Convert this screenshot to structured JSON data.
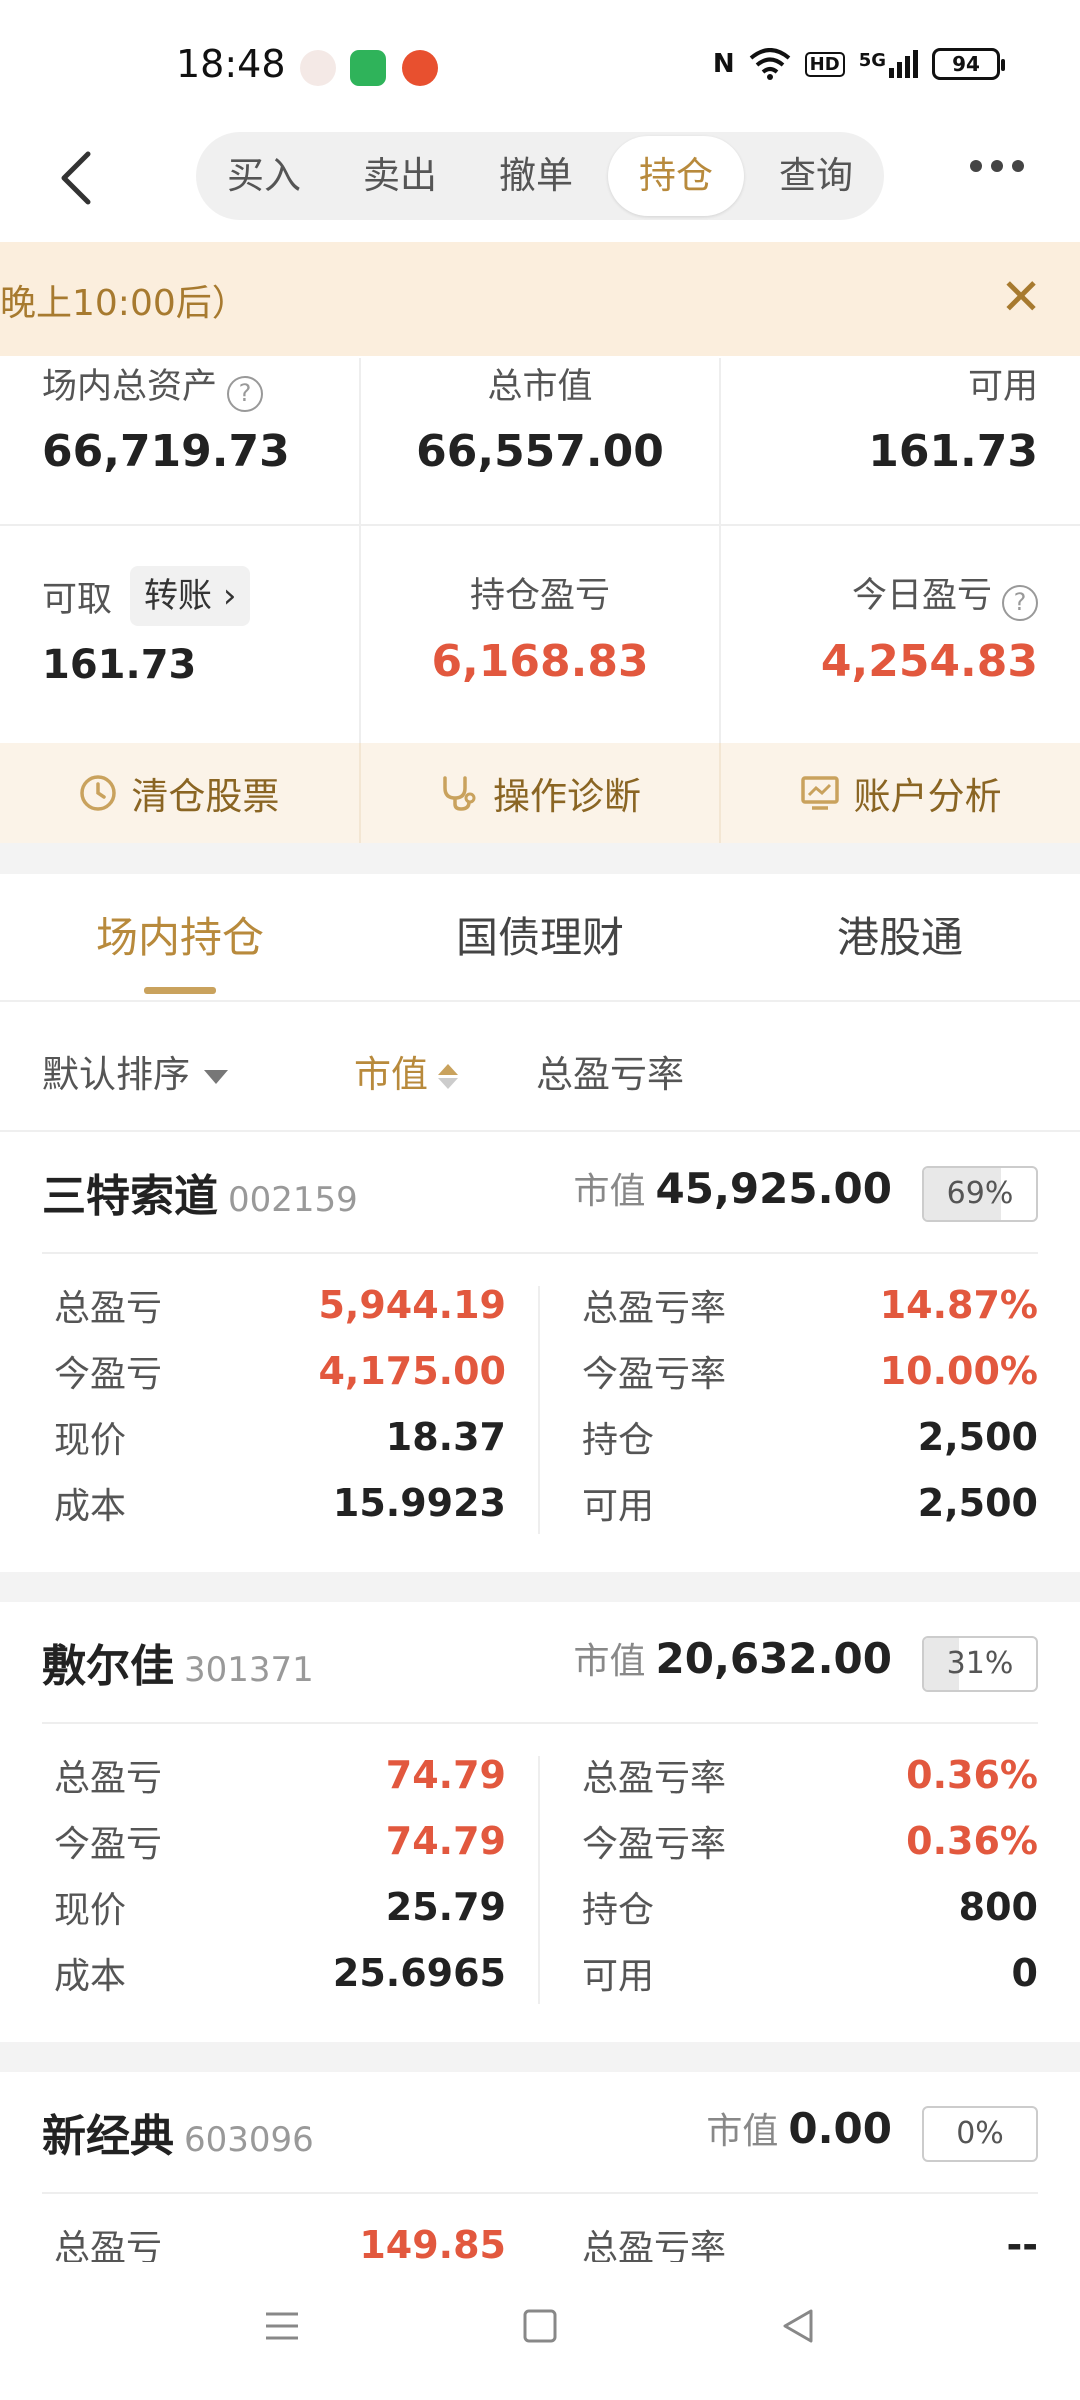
{
  "status_bar": {
    "time": "18:48",
    "network": "5G",
    "hd": "HD",
    "nfc": "N",
    "battery": "94"
  },
  "header": {
    "tabs": [
      {
        "label": "买入",
        "active": false
      },
      {
        "label": "卖出",
        "active": false
      },
      {
        "label": "撤单",
        "active": false
      },
      {
        "label": "持仓",
        "active": true
      },
      {
        "label": "查询",
        "active": false
      }
    ]
  },
  "notice": {
    "text": "晚上10:00后）"
  },
  "summary": {
    "total_assets_label": "场内总资产",
    "total_assets": "66,719.73",
    "market_value_label": "总市值",
    "market_value": "66,557.00",
    "available_label": "可用",
    "available": "161.73",
    "withdrawable_label": "可取",
    "transfer_label": "转账",
    "withdrawable": "161.73",
    "position_pl_label": "持仓盈亏",
    "position_pl": "6,168.83",
    "today_pl_label": "今日盈亏",
    "today_pl": "4,254.83"
  },
  "actions": [
    {
      "label": "清仓股票",
      "icon": "clock-icon"
    },
    {
      "label": "操作诊断",
      "icon": "stethoscope-icon"
    },
    {
      "label": "账户分析",
      "icon": "chart-monitor-icon"
    }
  ],
  "subtabs": [
    {
      "label": "场内持仓",
      "active": true
    },
    {
      "label": "国债理财",
      "active": false
    },
    {
      "label": "港股通",
      "active": false
    }
  ],
  "sort": {
    "default": "默认排序",
    "market_value": "市值",
    "total_pl_rate": "总盈亏率"
  },
  "holdings": [
    {
      "name": "三特索道",
      "code": "002159",
      "mv_label": "市值",
      "market_value": "45,925.00",
      "weight": "69%",
      "weight_fraction": 0.69,
      "total_pl_label": "总盈亏",
      "total_pl": "5,944.19",
      "today_pl_label": "今盈亏",
      "today_pl": "4,175.00",
      "price_label": "现价",
      "price": "18.37",
      "cost_label": "成本",
      "cost": "15.9923",
      "total_pl_rate_label": "总盈亏率",
      "total_pl_rate": "14.87%",
      "today_pl_rate_label": "今盈亏率",
      "today_pl_rate": "10.00%",
      "position_label": "持仓",
      "position": "2,500",
      "available_label": "可用",
      "available": "2,500"
    },
    {
      "name": "敷尔佳",
      "code": "301371",
      "mv_label": "市值",
      "market_value": "20,632.00",
      "weight": "31%",
      "weight_fraction": 0.31,
      "total_pl_label": "总盈亏",
      "total_pl": "74.79",
      "today_pl_label": "今盈亏",
      "today_pl": "74.79",
      "price_label": "现价",
      "price": "25.79",
      "cost_label": "成本",
      "cost": "25.6965",
      "total_pl_rate_label": "总盈亏率",
      "total_pl_rate": "0.36%",
      "today_pl_rate_label": "今盈亏率",
      "today_pl_rate": "0.36%",
      "position_label": "持仓",
      "position": "800",
      "available_label": "可用",
      "available": "0"
    },
    {
      "name": "新经典",
      "code": "603096",
      "mv_label": "市值",
      "market_value": "0.00",
      "weight": "0%",
      "weight_fraction": 0,
      "total_pl_label": "总盈亏",
      "total_pl": "149.85",
      "total_pl_rate_label": "总盈亏率",
      "total_pl_rate": "--"
    }
  ],
  "colors": {
    "accent": "#b88a3c",
    "profit": "#e2583e",
    "banner_bg": "#fbeedd"
  }
}
